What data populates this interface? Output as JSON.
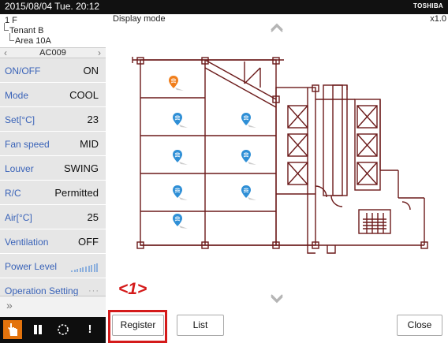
{
  "topbar": {
    "datetime": "2015/08/04  Tue.  20:12",
    "brand": "TOSHIBA"
  },
  "tree": {
    "floor": "1 F",
    "tenant": "Tenant B",
    "area": "Area 10A"
  },
  "unit_nav": {
    "name": "AC009"
  },
  "status_rows": [
    {
      "label": "ON/OFF",
      "value": "ON"
    },
    {
      "label": "Mode",
      "value": "COOL"
    },
    {
      "label": "Set[°C]",
      "value": "23"
    },
    {
      "label": "Fan speed",
      "value": "MID"
    },
    {
      "label": "Louver",
      "value": "SWING"
    },
    {
      "label": "R/C",
      "value": "Permitted"
    },
    {
      "label": "Air[°C]",
      "value": "25"
    },
    {
      "label": "Ventilation",
      "value": "OFF"
    },
    {
      "label": "Power Level",
      "value": ""
    },
    {
      "label": "Operation Setting",
      "value": "···"
    }
  ],
  "power_level_bars": 10,
  "main": {
    "title": "Display mode",
    "zoom": "x1.0"
  },
  "annotation": "<1>",
  "buttons": {
    "register": "Register",
    "list": "List",
    "close": "Close"
  },
  "markers": [
    {
      "color": "#f07e1b",
      "selected": true
    },
    {
      "color": "#2f8fd6",
      "selected": false
    },
    {
      "color": "#2f8fd6",
      "selected": false
    },
    {
      "color": "#2f8fd6",
      "selected": false
    },
    {
      "color": "#2f8fd6",
      "selected": false
    },
    {
      "color": "#2f8fd6",
      "selected": false
    },
    {
      "color": "#2f8fd6",
      "selected": false
    },
    {
      "color": "#2f8fd6",
      "selected": false
    }
  ],
  "colors": {
    "accent": "#e3730d",
    "label_blue": "#3a63b8",
    "highlight_red": "#d41a1a",
    "wall": "#6b1a1a"
  }
}
